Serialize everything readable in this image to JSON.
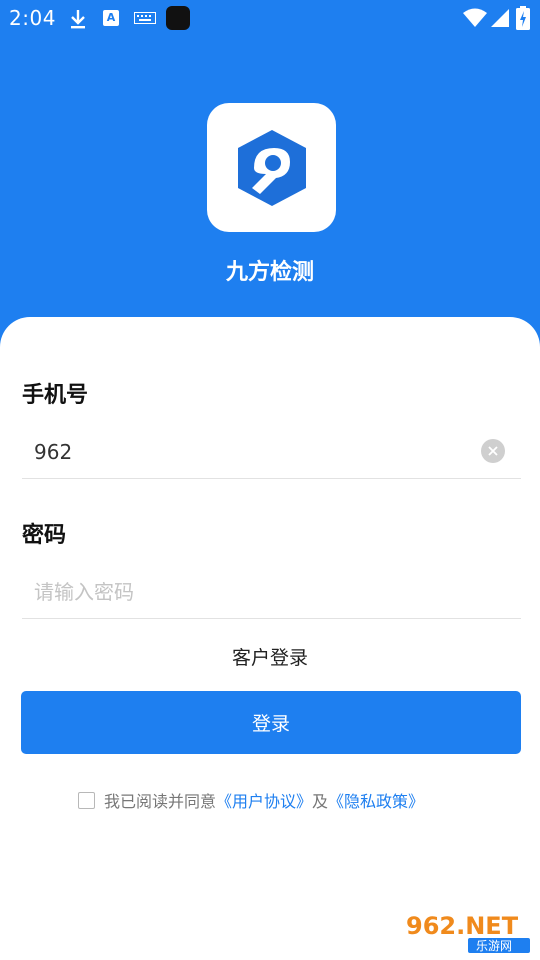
{
  "status_bar": {
    "time": "2:04",
    "icons": [
      "download-icon",
      "a-notification-icon",
      "keyboard-icon",
      "app-square-icon",
      "wifi-icon",
      "signal-icon",
      "battery-charging-icon"
    ]
  },
  "app": {
    "name": "九方检测",
    "logo_icon": "nine-hexagon-logo-icon"
  },
  "form": {
    "phone_label": "手机号",
    "phone_value": "962",
    "password_label": "密码",
    "password_placeholder": "请输入密码",
    "customer_login": "客户登录",
    "login_button": "登录"
  },
  "agreement": {
    "prefix": "我已阅读并同意",
    "user_agreement": "《用户协议》",
    "and": "及",
    "privacy_policy": "《隐私政策》"
  },
  "watermark": {
    "top": "962.NET",
    "bottom": "乐游网"
  },
  "colors": {
    "primary": "#1E7FF0",
    "sheet": "#FFFFFF",
    "placeholder": "#C4C4C4"
  }
}
